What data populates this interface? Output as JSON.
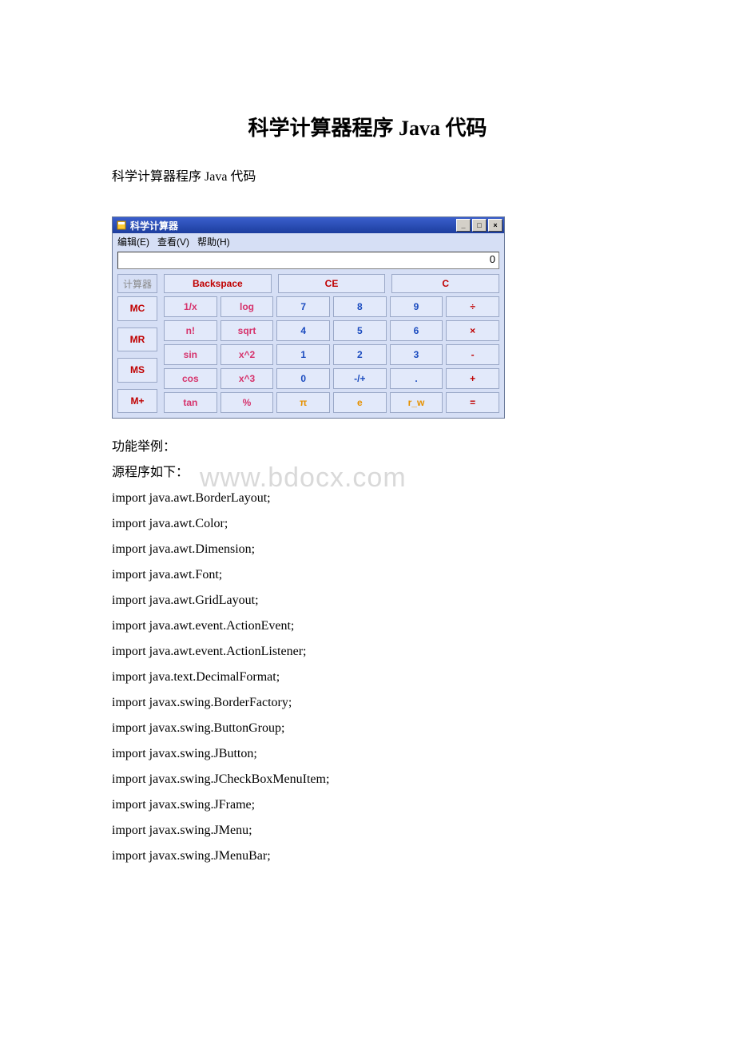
{
  "doc": {
    "title": "科学计算器程序 Java 代码",
    "subtitle": "科学计算器程序 Java 代码",
    "section_example": "功能举例：",
    "section_source": "源程序如下：",
    "watermark": "www.bdocx.com"
  },
  "calc": {
    "title": "科学计算器",
    "menu": {
      "edit": "编辑(E)",
      "view": "查看(V)",
      "help": "帮助(H)"
    },
    "display_value": "0",
    "tab_label": "计算器",
    "top_buttons": {
      "backspace": "Backspace",
      "ce": "CE",
      "c": "C"
    },
    "mem_buttons": [
      "MC",
      "MR",
      "MS",
      "M+"
    ],
    "grid": [
      [
        {
          "t": "1/x",
          "cls": "c-pink"
        },
        {
          "t": "log",
          "cls": "c-pink"
        },
        {
          "t": "7",
          "cls": "c-blue"
        },
        {
          "t": "8",
          "cls": "c-blue"
        },
        {
          "t": "9",
          "cls": "c-blue"
        },
        {
          "t": "÷",
          "cls": "c-red"
        }
      ],
      [
        {
          "t": "n!",
          "cls": "c-pink"
        },
        {
          "t": "sqrt",
          "cls": "c-pink"
        },
        {
          "t": "4",
          "cls": "c-blue"
        },
        {
          "t": "5",
          "cls": "c-blue"
        },
        {
          "t": "6",
          "cls": "c-blue"
        },
        {
          "t": "×",
          "cls": "c-red"
        }
      ],
      [
        {
          "t": "sin",
          "cls": "c-pink"
        },
        {
          "t": "x^2",
          "cls": "c-pink"
        },
        {
          "t": "1",
          "cls": "c-blue"
        },
        {
          "t": "2",
          "cls": "c-blue"
        },
        {
          "t": "3",
          "cls": "c-blue"
        },
        {
          "t": "-",
          "cls": "c-red"
        }
      ],
      [
        {
          "t": "cos",
          "cls": "c-pink"
        },
        {
          "t": "x^3",
          "cls": "c-pink"
        },
        {
          "t": "0",
          "cls": "c-blue"
        },
        {
          "t": "-/+",
          "cls": "c-blue"
        },
        {
          "t": ".",
          "cls": "c-blue"
        },
        {
          "t": "+",
          "cls": "c-red"
        }
      ],
      [
        {
          "t": "tan",
          "cls": "c-pink"
        },
        {
          "t": "%",
          "cls": "c-pink"
        },
        {
          "t": "π",
          "cls": "c-orange"
        },
        {
          "t": "e",
          "cls": "c-orange"
        },
        {
          "t": "r_w",
          "cls": "c-orange"
        },
        {
          "t": "=",
          "cls": "c-red"
        }
      ]
    ]
  },
  "code_lines": [
    "import java.awt.BorderLayout;",
    "import java.awt.Color;",
    "import java.awt.Dimension;",
    "import java.awt.Font;",
    "import java.awt.GridLayout;",
    "import java.awt.event.ActionEvent;",
    "import java.awt.event.ActionListener;",
    "import java.text.DecimalFormat;",
    "import javax.swing.BorderFactory;",
    "import javax.swing.ButtonGroup;",
    "import javax.swing.JButton;",
    "import javax.swing.JCheckBoxMenuItem;",
    "import javax.swing.JFrame;",
    "import javax.swing.JMenu;",
    "import javax.swing.JMenuBar;"
  ]
}
